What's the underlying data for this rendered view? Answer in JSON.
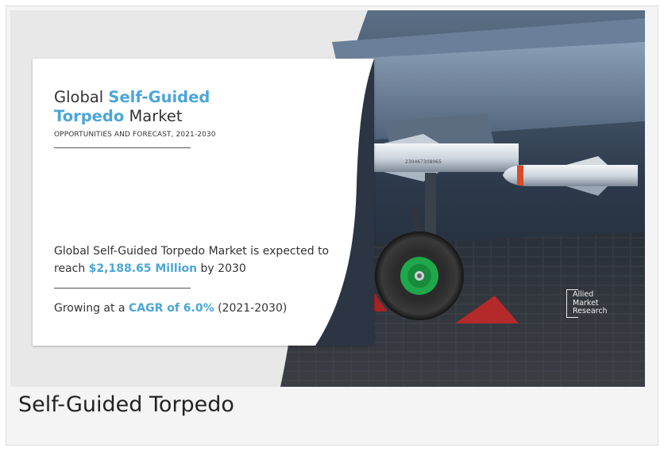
{
  "caption": "Self-Guided Torpedo",
  "infographic": {
    "title_prefix": "Global ",
    "title_accent_1": "Self-Guided",
    "title_accent_2": "Torpedo",
    "title_suffix": " Market",
    "subtitle": "OPPORTUNITIES AND FORECAST, 2021-2030",
    "stat_prefix": "Global Self-Guided Torpedo Market is expected to reach ",
    "stat_value": "$2,188.65 Million",
    "stat_suffix": " by 2030",
    "cagr_prefix": "Growing at a ",
    "cagr_value": "CAGR of 6.0%",
    "cagr_suffix": " (2021-2030)",
    "missile_marking": "230467308065",
    "logo_lines": [
      "Allied",
      "Market",
      "Research"
    ]
  },
  "colors": {
    "accent": "#4ba6d9",
    "text": "#333333",
    "wheel_green": "#1fa84b",
    "chock_red": "#b4292a"
  }
}
